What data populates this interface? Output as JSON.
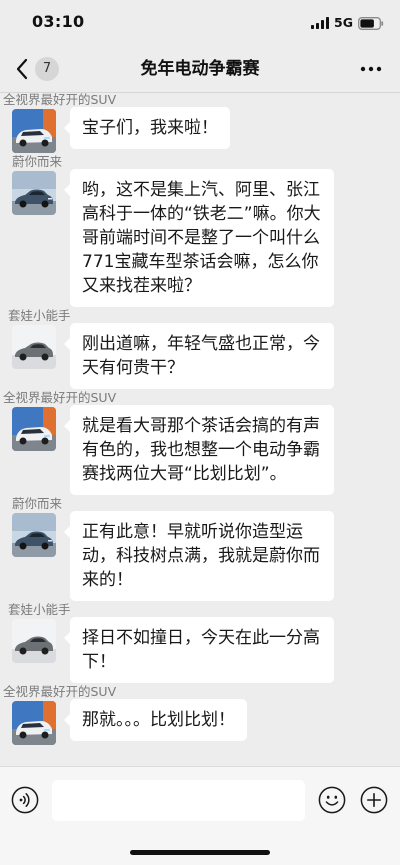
{
  "theme": {
    "chat_background": "#ededed",
    "bubble_color": "#ffffff",
    "input_bar_background": "#f6f6f6",
    "text_color": "#191919",
    "sender_name_color": "#7b7b7b",
    "badge_color": "#d6d6d6"
  },
  "status_bar": {
    "time": "03:10",
    "network": "5G",
    "signal_bars": 4,
    "signal_max": 4,
    "battery_level": 0.75,
    "signal_icon": "signal-icon",
    "battery_icon": "battery-icon"
  },
  "nav": {
    "back_icon": "chevron-left-icon",
    "unread_count": "7",
    "title": "免年电动争霸赛",
    "more_icon": "more-dots-icon"
  },
  "messages": [
    {
      "sender": "全视界最好开的SUV",
      "avatar": "silver-suv-avatar",
      "text": "宝子们，我来啦！"
    },
    {
      "sender": "蔚你而来",
      "avatar": "slate-sedan-avatar",
      "text": "哟，这不是集上汽、阿里、张江高科于一体的“铁老二”嘛。你大哥前端时间不是整了一个叫什么771宝藏车型茶话会嘛，怎么你又来找茬来啦？"
    },
    {
      "sender": "套娃小能手",
      "avatar": "gray-car-avatar",
      "text": "刚出道嘛，年轻气盛也正常，今天有何贵干？"
    },
    {
      "sender": "全视界最好开的SUV",
      "avatar": "silver-suv-avatar",
      "text": "就是看大哥那个茶话会搞的有声有色的，我也想整一个电动争霸赛找两位大哥“比划比划”。"
    },
    {
      "sender": "蔚你而来",
      "avatar": "slate-sedan-avatar",
      "text": "正有此意！早就听说你造型运动，科技树点满，我就是蔚你而来的！"
    },
    {
      "sender": "套娃小能手",
      "avatar": "gray-car-avatar",
      "text": "择日不如撞日，今天在此一分高下！"
    },
    {
      "sender": "全视界最好开的SUV",
      "avatar": "silver-suv-avatar",
      "text": "那就。。。比划比划！"
    }
  ],
  "input_bar": {
    "voice_icon": "voice-icon",
    "emoji_icon": "emoji-icon",
    "plus_icon": "plus-icon"
  }
}
